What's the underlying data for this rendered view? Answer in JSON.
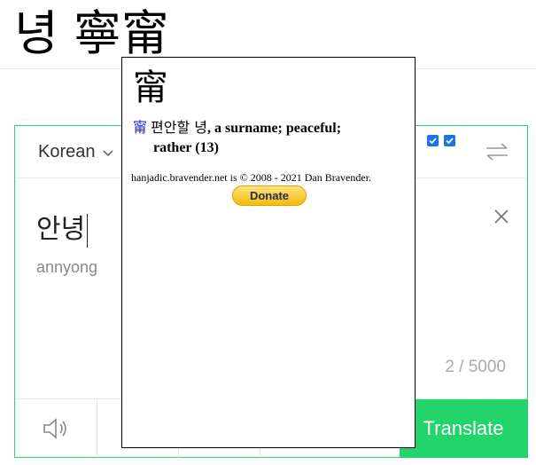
{
  "heading": {
    "text": "녕 寧甯"
  },
  "translator": {
    "source_language": "Korean",
    "source_text": "안녕",
    "romanization": "annyong",
    "char_count": "2 / 5000",
    "translate_label": "Translate"
  },
  "popup": {
    "hanja": "甯",
    "entry_hanja": "甯",
    "entry_korean": "편안할 녕",
    "entry_definition": ", a surname; peaceful;",
    "entry_definition_2": "rather (13)",
    "credit": "hanjadic.bravender.net is © 2008 - 2021 Dan Bravender.",
    "donate_label": "Donate"
  },
  "colors": {
    "accent_green": "#22d46a",
    "checkbox_blue": "#1a73e8",
    "hanja_link_blue": "#1a1adf"
  },
  "icons": [
    "chevron-down-icon",
    "checkbox-icon",
    "swap-icon",
    "close-icon",
    "speaker-icon"
  ]
}
